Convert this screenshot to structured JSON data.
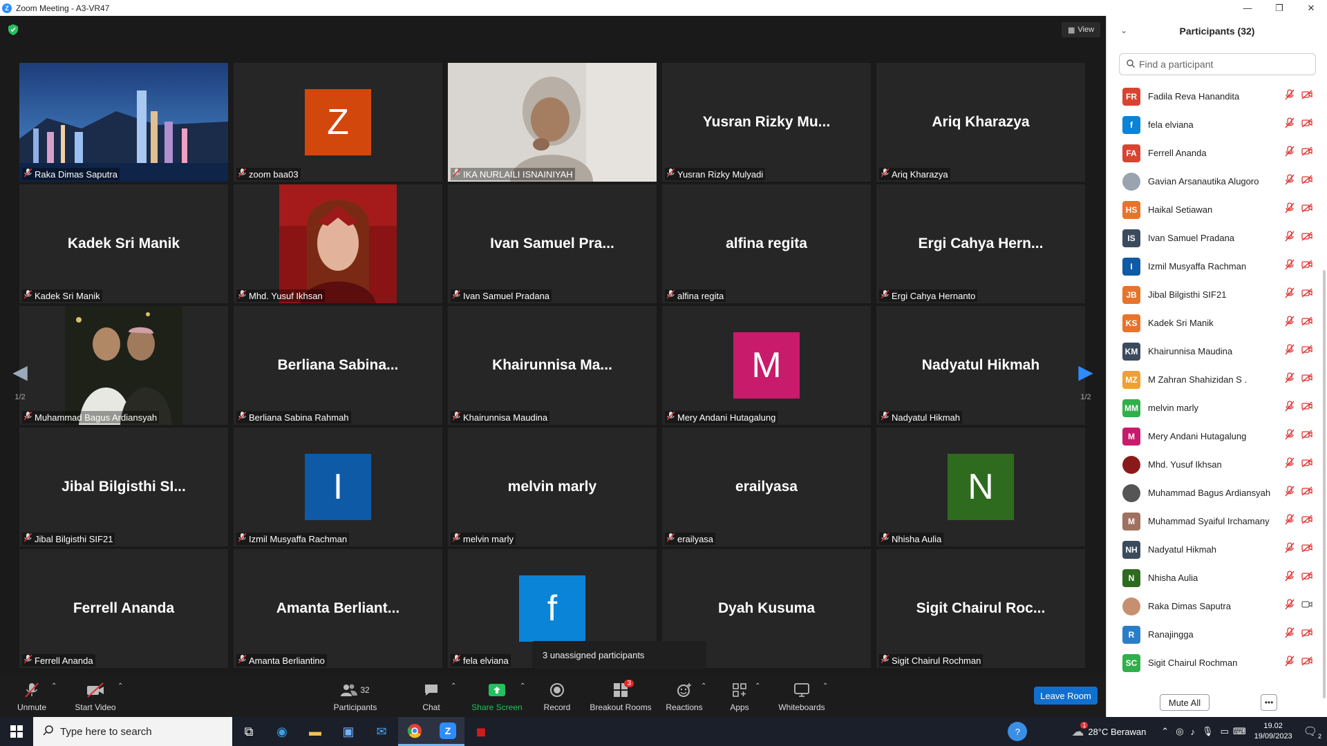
{
  "window": {
    "title": "Zoom Meeting - A3-VR47",
    "minimize": "—",
    "maximize": "❐",
    "close": "✕"
  },
  "meeting": {
    "view_label": "View",
    "tiles": [
      {
        "name": "Raka Dimas Saputra",
        "type": "photo",
        "photo": "city",
        "big": ""
      },
      {
        "name": "zoom baa03",
        "type": "avatar",
        "letter": "Z",
        "color": "#d2470c"
      },
      {
        "name": "IKA NURLAILI ISNAINIYAH",
        "type": "photo",
        "photo": "face",
        "speaking": true
      },
      {
        "name": "Yusran Rizky Mulyadi",
        "type": "text",
        "big": "Yusran  Rizky  Mu..."
      },
      {
        "name": "Ariq Kharazya",
        "type": "text",
        "big": "Ariq Kharazya"
      },
      {
        "name": "Kadek Sri Manik",
        "type": "text",
        "big": "Kadek Sri Manik"
      },
      {
        "name": "Mhd. Yusuf Ikhsan",
        "type": "photo",
        "photo": "red"
      },
      {
        "name": "Ivan Samuel Pradana",
        "type": "text",
        "big": "Ivan Samuel Pra..."
      },
      {
        "name": "alfina regita",
        "type": "text",
        "big": "alfina regita"
      },
      {
        "name": "Ergi Cahya Hernanto",
        "type": "text",
        "big": "Ergi Cahya Hern..."
      },
      {
        "name": "Muhammad Bagus Ardiansyah",
        "type": "photo",
        "photo": "dark"
      },
      {
        "name": "Berliana Sabina Rahmah",
        "type": "text",
        "big": "Berliana  Sabina..."
      },
      {
        "name": "Khairunnisa Maudina",
        "type": "text",
        "big": "Khairunnisa  Ma..."
      },
      {
        "name": "Mery Andani Hutagalung",
        "type": "avatar",
        "letter": "M",
        "color": "#c81b6b"
      },
      {
        "name": "Nadyatul Hikmah",
        "type": "text",
        "big": "Nadyatul Hikmah"
      },
      {
        "name": "Jibal Bilgisthi SIF21",
        "type": "text",
        "big": "Jibal Bilgisthi SI..."
      },
      {
        "name": "Izmil Musyaffa Rachman",
        "type": "avatar",
        "letter": "I",
        "color": "#0e5aa7"
      },
      {
        "name": "melvin marly",
        "type": "text",
        "big": "melvin marly"
      },
      {
        "name": "erailyasa",
        "type": "text",
        "big": "erailyasa"
      },
      {
        "name": "Nhisha Aulia",
        "type": "avatar",
        "letter": "N",
        "color": "#2f6b1f"
      },
      {
        "name": "Ferrell Ananda",
        "type": "text",
        "big": "Ferrell Ananda"
      },
      {
        "name": "Amanta Berliantino",
        "type": "text",
        "big": "Amanta  Berliant..."
      },
      {
        "name": "fela elviana",
        "type": "avatar",
        "letter": "f",
        "color": "#0a84d6"
      },
      {
        "name": "Dyah Kusuma",
        "type": "text",
        "big": "Dyah Kusuma",
        "label_shown": "usuma"
      },
      {
        "name": "Sigit Chairul Rochman",
        "type": "text",
        "big": "Sigit  Chairul  Roc..."
      }
    ],
    "page_left": "1/2",
    "page_right": "1/2",
    "tooltip": "3 unassigned participants"
  },
  "toolbar": {
    "unmute": "Unmute",
    "start_video": "Start Video",
    "participants": "Participants",
    "participants_count": "32",
    "chat": "Chat",
    "share_screen": "Share Screen",
    "record": "Record",
    "breakout_rooms": "Breakout Rooms",
    "breakout_badge": "3",
    "reactions": "Reactions",
    "apps": "Apps",
    "whiteboards": "Whiteboards",
    "leave": "Leave Room"
  },
  "panel": {
    "title": "Participants (32)",
    "search_placeholder": "Find a participant",
    "participants": [
      {
        "initials": "FR",
        "name": "Fadila Reva Hanandita",
        "color": "#d94432"
      },
      {
        "initials": "f",
        "name": "fela elviana",
        "color": "#0a84d6"
      },
      {
        "initials": "FA",
        "name": "Ferrell Ananda",
        "color": "#d94432"
      },
      {
        "initials": "",
        "name": "Gavian Arsanautika Alugoro",
        "color": "#9aa3b0",
        "photo": true
      },
      {
        "initials": "HS",
        "name": "Haikal Setiawan",
        "color": "#e8732b"
      },
      {
        "initials": "IS",
        "name": "Ivan Samuel Pradana",
        "color": "#3b4a5c"
      },
      {
        "initials": "I",
        "name": "Izmil Musyaffa Rachman",
        "color": "#0e5aa7"
      },
      {
        "initials": "JB",
        "name": "Jibal Bilgisthi SIF21",
        "color": "#e8732b"
      },
      {
        "initials": "KS",
        "name": "Kadek Sri Manik",
        "color": "#e8732b"
      },
      {
        "initials": "KM",
        "name": "Khairunnisa Maudina",
        "color": "#3b4a5c"
      },
      {
        "initials": "MZ",
        "name": "M Zahran Shahizidan S .",
        "color": "#f0a030"
      },
      {
        "initials": "MM",
        "name": "melvin marly",
        "color": "#30b04a"
      },
      {
        "initials": "M",
        "name": "Mery Andani Hutagalung",
        "color": "#c81b6b"
      },
      {
        "initials": "",
        "name": "Mhd. Yusuf Ikhsan",
        "color": "#8a1a1a",
        "photo": true
      },
      {
        "initials": "",
        "name": "Muhammad Bagus Ardiansyah",
        "color": "#555555",
        "photo": true
      },
      {
        "initials": "M",
        "name": "Muhammad Syaiful Irchamany",
        "color": "#a07060"
      },
      {
        "initials": "NH",
        "name": "Nadyatul Hikmah",
        "color": "#3b4a5c"
      },
      {
        "initials": "N",
        "name": "Nhisha Aulia",
        "color": "#2f6b1f"
      },
      {
        "initials": "",
        "name": "Raka Dimas Saputra",
        "color": "#c69070",
        "photo": true,
        "video_on": true
      },
      {
        "initials": "R",
        "name": "Ranajingga",
        "color": "#2a7ec8"
      },
      {
        "initials": "SC",
        "name": "Sigit Chairul Rochman",
        "color": "#30b04a"
      }
    ],
    "mute_all": "Mute All",
    "more": "•••"
  },
  "taskbar": {
    "search_placeholder": "Type here to search",
    "weather": "28°C  Berawan",
    "time": "19.02",
    "date": "19/09/2023",
    "notif_count": "2",
    "weather_badge": "1"
  },
  "colors": {
    "speaking_outline": "#e8e86b",
    "mic_muted": "#e03030",
    "share_green": "#21c15e",
    "leave_blue": "#1170cf"
  }
}
